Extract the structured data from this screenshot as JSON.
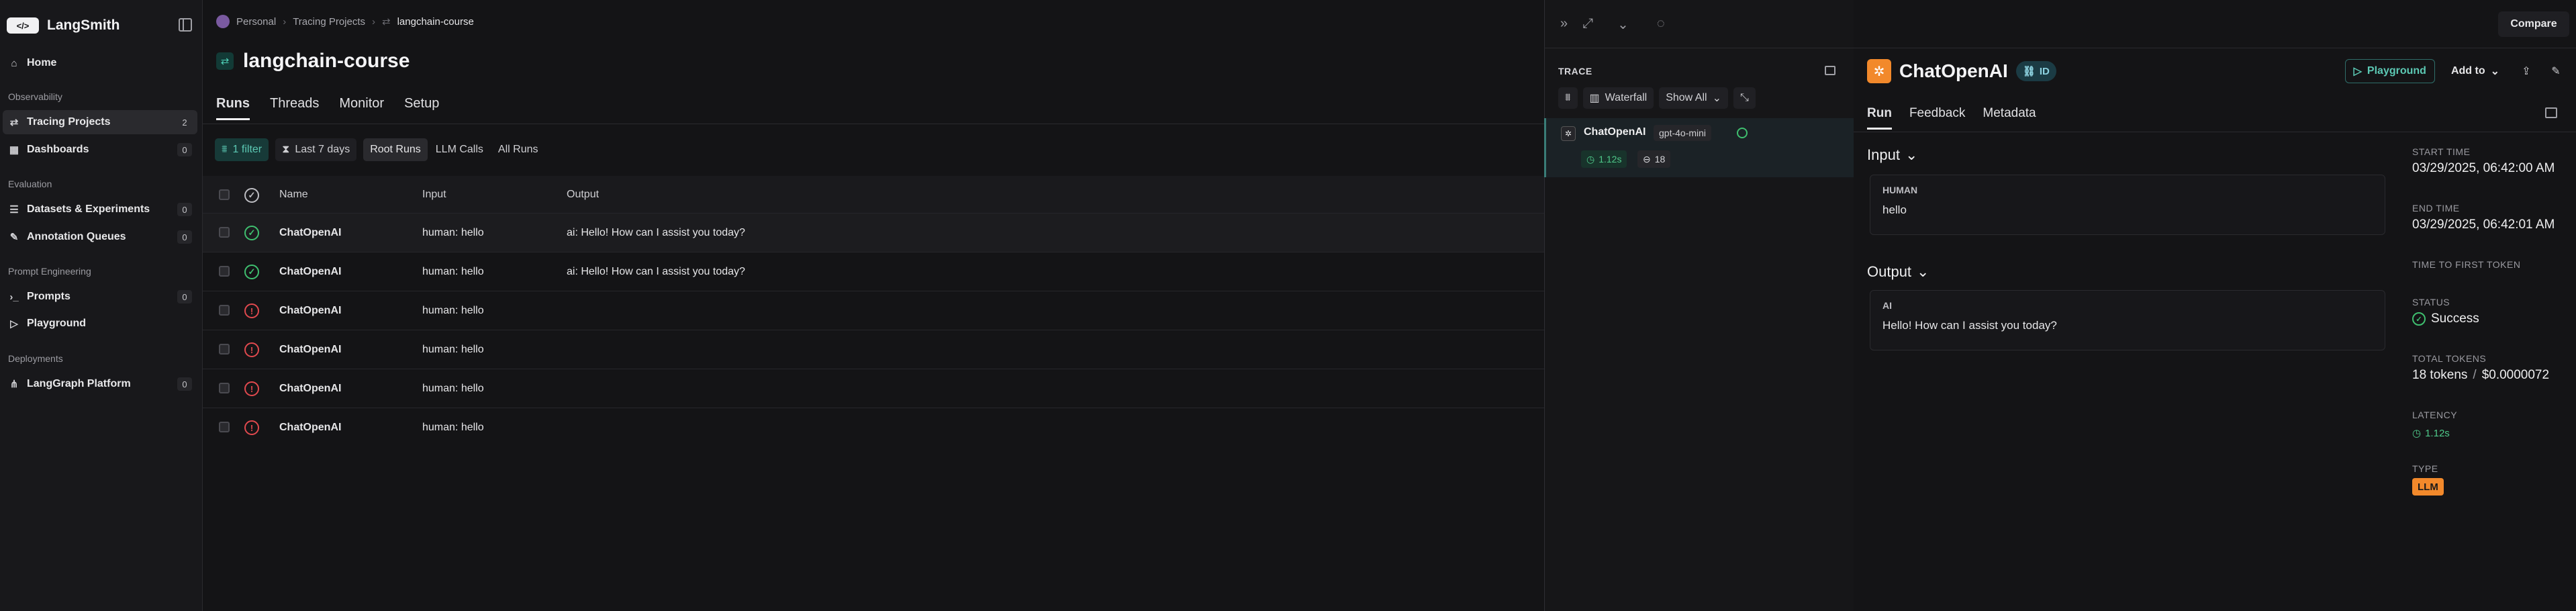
{
  "brand": {
    "name": "LangSmith",
    "logo_text": "</>"
  },
  "sidebar": {
    "home": "Home",
    "sections": {
      "observability": "Observability",
      "evaluation": "Evaluation",
      "prompt_engineering": "Prompt Engineering",
      "deployments": "Deployments"
    },
    "items": [
      {
        "label": "Tracing Projects",
        "count": "2"
      },
      {
        "label": "Dashboards",
        "count": "0"
      },
      {
        "label": "Datasets & Experiments",
        "count": "0"
      },
      {
        "label": "Annotation Queues",
        "count": "0"
      },
      {
        "label": "Prompts",
        "count": "0"
      },
      {
        "label": "Playground",
        "count": ""
      },
      {
        "label": "LangGraph Platform",
        "count": "0"
      }
    ]
  },
  "breadcrumb": [
    "Personal",
    "Tracing Projects",
    "langchain-course"
  ],
  "project": {
    "name": "langchain-course"
  },
  "tabs": [
    "Runs",
    "Threads",
    "Monitor",
    "Setup"
  ],
  "filters": {
    "filter": "1 filter",
    "range": "Last 7 days",
    "segments": [
      "Root Runs",
      "LLM Calls",
      "All Runs"
    ]
  },
  "table": {
    "headers": {
      "name": "Name",
      "input": "Input",
      "output": "Output"
    },
    "rows": [
      {
        "status": "success",
        "name": "ChatOpenAI",
        "input": "human: hello",
        "output": "ai: Hello! How can I assist you today?"
      },
      {
        "status": "success",
        "name": "ChatOpenAI",
        "input": "human: hello",
        "output": "ai: Hello! How can I assist you today?"
      },
      {
        "status": "error",
        "name": "ChatOpenAI",
        "input": "human: hello",
        "output": ""
      },
      {
        "status": "error",
        "name": "ChatOpenAI",
        "input": "human: hello",
        "output": ""
      },
      {
        "status": "error",
        "name": "ChatOpenAI",
        "input": "human: hello",
        "output": ""
      },
      {
        "status": "error",
        "name": "ChatOpenAI",
        "input": "human: hello",
        "output": ""
      }
    ]
  },
  "trace": {
    "label": "TRACE",
    "waterfall": "Waterfall",
    "show_all": "Show All",
    "item": {
      "name": "ChatOpenAI",
      "model": "gpt-4o-mini",
      "latency": "1.12s",
      "tokens": "18"
    }
  },
  "compare_label": "Compare",
  "run": {
    "title": "ChatOpenAI",
    "id_label": "ID",
    "playground": "Playground",
    "add_to": "Add to",
    "tabs": [
      "Run",
      "Feedback",
      "Metadata"
    ],
    "input_title": "Input",
    "input_role": "HUMAN",
    "input_text": "hello",
    "output_title": "Output",
    "output_role": "AI",
    "output_text": "Hello! How can I assist you today?"
  },
  "meta": {
    "start_time_k": "START TIME",
    "start_time": "03/29/2025, 06:42:00 AM",
    "end_time_k": "END TIME",
    "end_time": "03/29/2025, 06:42:01 AM",
    "ttft_k": "TIME TO FIRST TOKEN",
    "status_k": "STATUS",
    "status": "Success",
    "total_tokens_k": "TOTAL TOKENS",
    "total_tokens": "18 tokens",
    "cost": "$0.0000072",
    "cost_sep": "/",
    "latency_k": "LATENCY",
    "latency": "1.12s",
    "type_k": "TYPE",
    "type": "LLM"
  },
  "colors": {
    "accent": "#5cc9b4",
    "success": "#3fbf6f",
    "error": "#e0494e",
    "llm_badge": "#f2892b"
  }
}
